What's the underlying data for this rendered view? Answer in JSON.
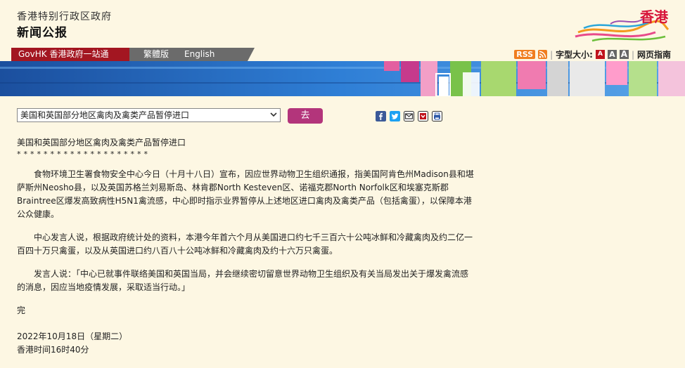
{
  "header": {
    "gov_title": "香港特别行政区政府",
    "press_title": "新闻公报",
    "brand": "香港"
  },
  "nav": {
    "govhk": "GovHK 香港政府一站通",
    "traditional": "繁體版",
    "english": "English"
  },
  "tools": {
    "rss": "RSS",
    "font_size_label": "字型大小:",
    "size_a": "A",
    "guide": "网页指南"
  },
  "controls": {
    "select_value": "美国和英国部分地区禽肉及禽类产品暂停进口",
    "go_label": "去"
  },
  "article": {
    "title": "美国和英国部分地区禽肉及禽类产品暂停进口",
    "stars": "********************",
    "paragraphs": [
      "食物环境卫生署食物安全中心今日（十月十八日）宣布，因应世界动物卫生组织通报，指美国阿肯色州Madison县和堪萨斯州Neosho县，以及英国苏格兰刘易斯岛、林肯郡North Kesteven区、诺福克郡North Norfolk区和埃塞克斯郡Braintree区爆发高致病性H5N1禽流感，中心即时指示业界暂停从上述地区进口禽肉及禽类产品（包括禽蛋），以保障本港公众健康。",
      "中心发言人说，根据政府统计处的资料，本港今年首六个月从美国进口约七千三百六十公吨冰鲜和冷藏禽肉及约二亿一百四十万只禽蛋，以及从英国进口约八百八十公吨冰鲜和冷藏禽肉及约十六万只禽蛋。",
      "发言人说：「中心已就事件联络美国和英国当局，并会继续密切留意世界动物卫生组织及有关当局发出关于爆发禽流感的消息，因应当地疫情发展，采取适当行动。」"
    ],
    "end": "完",
    "date": "2022年10月18日（星期二）",
    "time": "香港时间16时40分"
  },
  "colors": {
    "background": "#fdf7e3",
    "nav_red": "#a31621",
    "nav_grey": "#6b6b6b",
    "go_button": "#b3357b",
    "brand_red": "#d7143a"
  },
  "icons": {
    "share": [
      "facebook-icon",
      "twitter-icon",
      "email-icon",
      "bookmark-icon",
      "print-icon"
    ]
  }
}
